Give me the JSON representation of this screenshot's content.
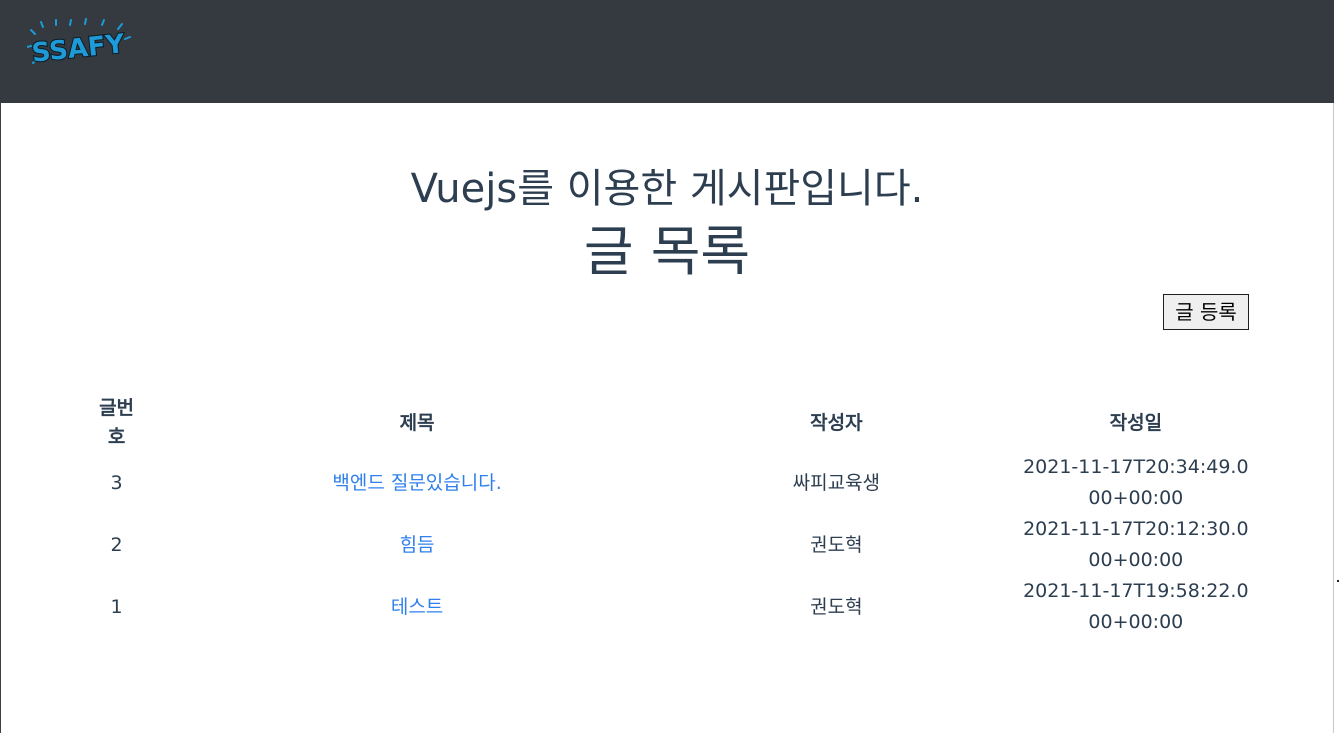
{
  "header": {
    "logo_text": "SSAFY",
    "background": "#343a40"
  },
  "page": {
    "main_title": "Vuejs를 이용한 게시판입니다.",
    "list_title": "글 목록",
    "write_button_label": "글 등록"
  },
  "table": {
    "columns": [
      "글번호",
      "제목",
      "작성자",
      "작성일"
    ],
    "rows": [
      {
        "no": "3",
        "subject": "백엔드 질문있습니다.",
        "author": "싸피교육생",
        "date": "2021-11-17T20:34:49.000+00:00"
      },
      {
        "no": "2",
        "subject": "힘듬",
        "author": "권도혁",
        "date": "2021-11-17T20:12:30.000+00:00"
      },
      {
        "no": "1",
        "subject": "테스트",
        "author": "권도혁",
        "date": "2021-11-17T19:58:22.000+00:00"
      }
    ]
  },
  "colors": {
    "text": "#2c3e50",
    "link": "#2f80ed",
    "logo_blue": "#1e9ad6"
  }
}
